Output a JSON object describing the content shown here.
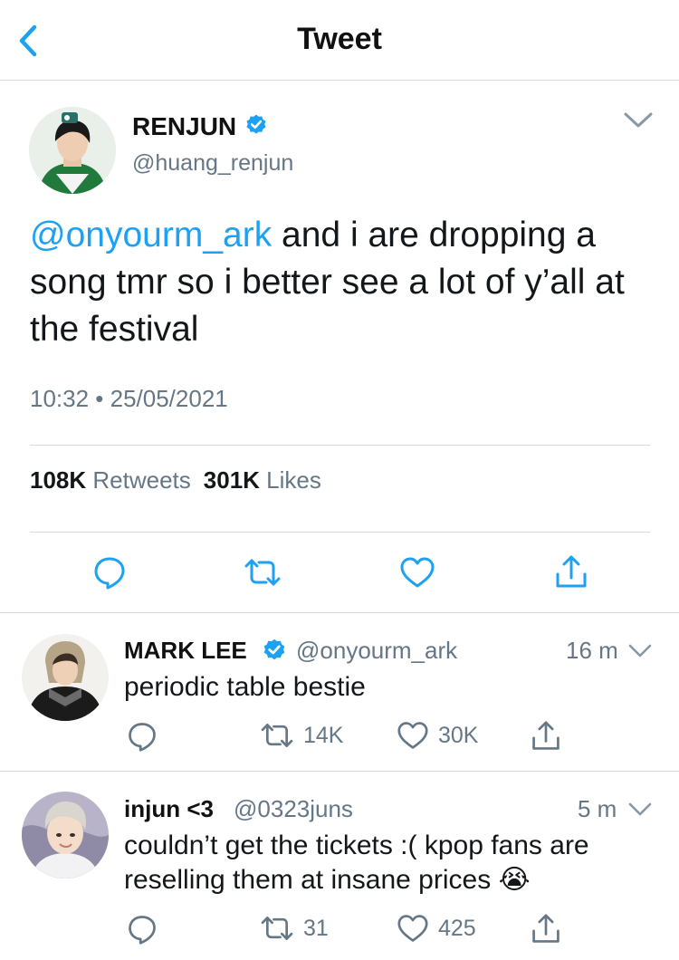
{
  "header": {
    "title": "Tweet",
    "back_icon": "chevron-left-icon"
  },
  "tweet": {
    "author": {
      "name": "RENJUN",
      "handle": "@huang_renjun",
      "verified": true
    },
    "mention": "@onyourm_ark",
    "text": " and i are dropping a song tmr so i better see a lot of y’all at the festival",
    "time": "10:32 • 25/05/2021",
    "stats": {
      "retweets_count": "108K",
      "retweets_label": "Retweets",
      "likes_count": "301K",
      "likes_label": "Likes"
    },
    "actions": [
      "reply-icon",
      "retweet-icon",
      "like-icon",
      "share-icon"
    ]
  },
  "replies": [
    {
      "name": "MARK LEE",
      "verified": true,
      "handle": "@onyourm_ark",
      "time": "16 m",
      "text": "periodic table bestie",
      "retweets": "14K",
      "likes": "30K"
    },
    {
      "name": "injun <3",
      "verified": false,
      "handle": "@0323juns",
      "time": "5 m",
      "text": "couldn’t get the tickets :( kpop fans are reselling them at insane prices",
      "emoji": "😭",
      "retweets": "31",
      "likes": "425"
    }
  ],
  "colors": {
    "accent": "#1da1f2",
    "secondary_text": "#657786",
    "divider": "#d6d9dc"
  }
}
